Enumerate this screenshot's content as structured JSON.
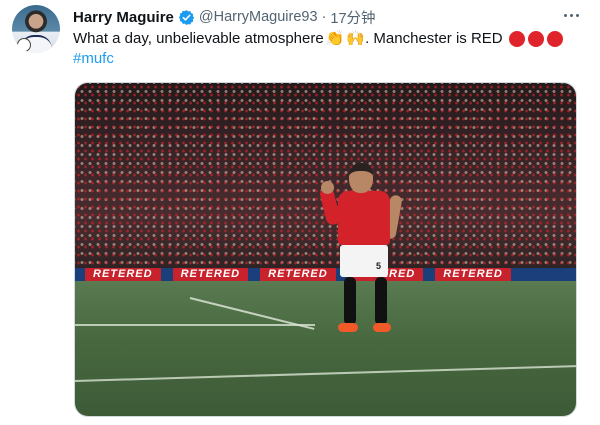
{
  "author": {
    "name": "Harry Maguire",
    "handle": "@HarryMaguire93",
    "separator": "·",
    "time": "17分钟",
    "verified_color": "#1d9bf0"
  },
  "tweet": {
    "text_part1": "What a day, unbelievable atmosphere",
    "emoji1": "👏",
    "emoji2": "🙌",
    "text_part2": ". Manchester is RED",
    "hashtag": "#mufc"
  },
  "media": {
    "ad_board_texts": [
      "RETERED",
      "RETERED",
      "RETERED",
      "RETERED",
      "RETERED"
    ],
    "player_number": "5"
  },
  "icons": {
    "more": "more-horizontal-icon",
    "verified": "verified-badge-icon"
  }
}
